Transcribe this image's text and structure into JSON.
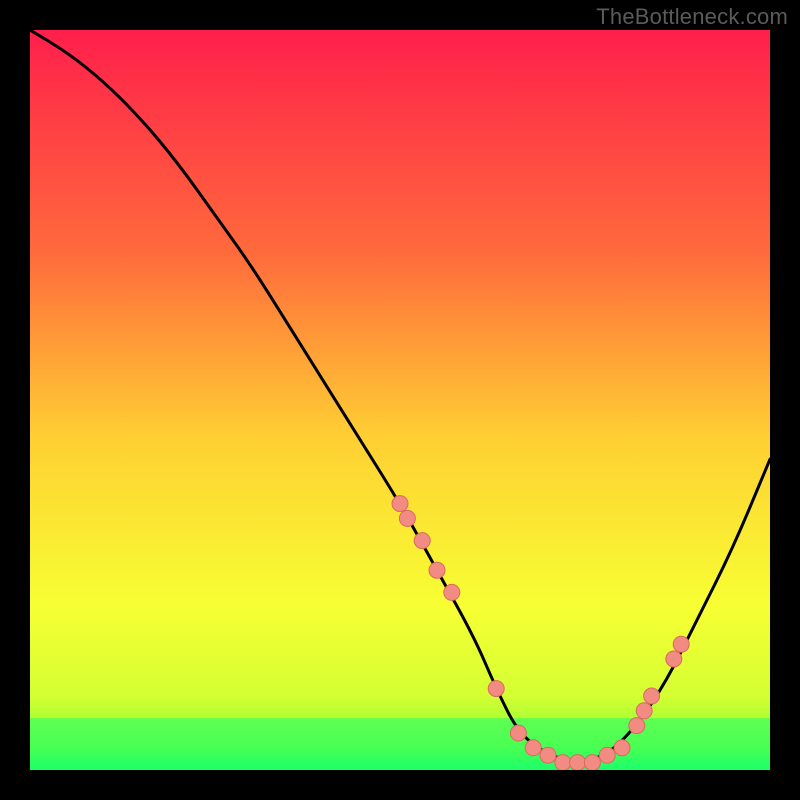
{
  "watermark": "TheBottleneck.com",
  "chart_data": {
    "type": "line",
    "title": "",
    "xlabel": "",
    "ylabel": "",
    "xlim": [
      0,
      100
    ],
    "ylim": [
      0,
      100
    ],
    "x": [
      0,
      5,
      10,
      15,
      20,
      25,
      30,
      35,
      40,
      45,
      50,
      55,
      60,
      63,
      66,
      70,
      74,
      78,
      82,
      86,
      90,
      95,
      100
    ],
    "values": [
      100,
      97,
      93,
      88,
      82,
      75,
      68,
      60,
      52,
      44,
      36,
      27,
      18,
      11,
      5,
      2,
      1,
      2,
      6,
      12,
      20,
      30,
      42
    ],
    "scatter": {
      "x": [
        50,
        51,
        53,
        55,
        57,
        63,
        66,
        68,
        70,
        72,
        74,
        76,
        78,
        80,
        82,
        83,
        84,
        87,
        88
      ],
      "y": [
        36,
        34,
        31,
        27,
        24,
        11,
        5,
        3,
        2,
        1,
        1,
        1,
        2,
        3,
        6,
        8,
        10,
        15,
        17
      ]
    },
    "green_band": {
      "top": 7,
      "bottom": 0
    },
    "gradient_stops": [
      {
        "offset": 0.0,
        "color": "#ff1f4b"
      },
      {
        "offset": 0.3,
        "color": "#ff6a3c"
      },
      {
        "offset": 0.55,
        "color": "#ffcf33"
      },
      {
        "offset": 0.78,
        "color": "#f7ff33"
      },
      {
        "offset": 0.9,
        "color": "#d4ff33"
      },
      {
        "offset": 0.97,
        "color": "#7fff33"
      },
      {
        "offset": 1.0,
        "color": "#1cff6b"
      }
    ]
  }
}
